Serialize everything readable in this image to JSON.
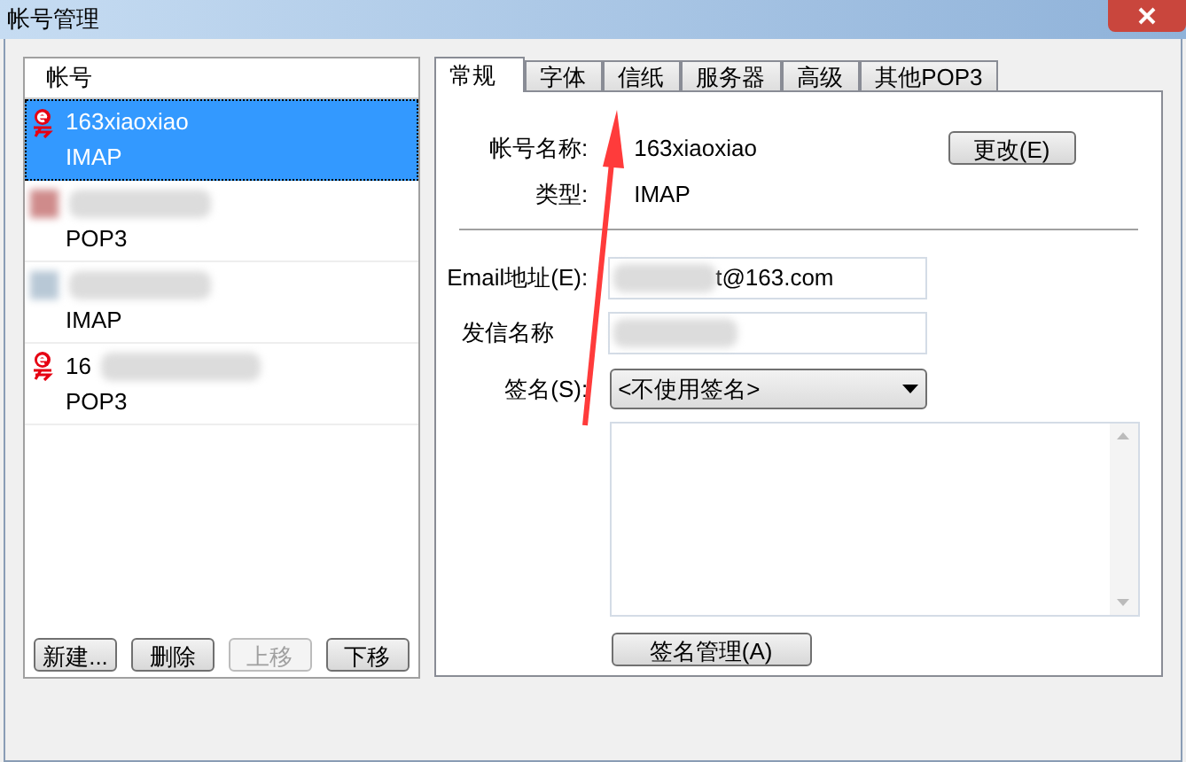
{
  "window": {
    "title": "帐号管理"
  },
  "accounts": {
    "header": "帐号",
    "items": [
      {
        "kind": "netease",
        "name": "163xiaoxiao",
        "name_redacted": false,
        "protocol": "IMAP",
        "selected": true
      },
      {
        "kind": "redacted",
        "name_redacted": true,
        "protocol": "POP3",
        "selected": false
      },
      {
        "kind": "redacted",
        "name_redacted": true,
        "protocol": "IMAP",
        "selected": false
      },
      {
        "kind": "netease",
        "name": "16",
        "name_redacted": true,
        "protocol": "POP3",
        "selected": false
      }
    ],
    "buttons": [
      {
        "label": "新建...",
        "disabled": false
      },
      {
        "label": "删除",
        "disabled": false
      },
      {
        "label": "上移",
        "disabled": true
      },
      {
        "label": "下移",
        "disabled": false
      }
    ]
  },
  "tabs": [
    {
      "label": "常规",
      "selected": true
    },
    {
      "label": "字体",
      "selected": false
    },
    {
      "label": "信纸",
      "selected": false
    },
    {
      "label": "服务器",
      "selected": false
    },
    {
      "label": "高级",
      "selected": false
    },
    {
      "label": "其他POP3",
      "selected": false
    }
  ],
  "general": {
    "account_name_label": "帐号名称:",
    "account_name": "163xiaoxiao",
    "change_button": "更改(E)",
    "type_label": "类型:",
    "type": "IMAP",
    "email_label": "Email地址(E):",
    "email": "t@163.com",
    "email_redacted": true,
    "sender_label": "发信名称",
    "sender_redacted": true,
    "signature_label": "签名(S):",
    "signature": "<不使用签名>",
    "signature_manage_button": "签名管理(A)"
  },
  "annotation": {
    "kind": "arrow"
  }
}
